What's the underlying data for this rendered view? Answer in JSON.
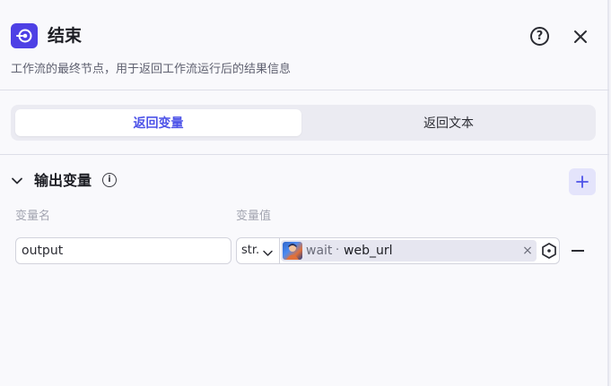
{
  "header": {
    "icon": "end-node-icon",
    "title": "结束",
    "description": "工作流的最终节点，用于返回工作流运行后的结果信息",
    "help_icon": "question-circle-icon",
    "close_icon": "close-icon"
  },
  "tabs": [
    {
      "label": "返回变量",
      "active": true
    },
    {
      "label": "返回文本",
      "active": false
    }
  ],
  "output_section": {
    "title": "输出变量",
    "info_icon": "info-icon",
    "add_icon": "plus-icon",
    "columns": {
      "name": "变量名",
      "value": "变量值"
    },
    "rows": [
      {
        "name": "output",
        "type": "str.",
        "ref_node": "wait",
        "ref_sep": "·",
        "ref_var": "web_url",
        "clear_label": "×"
      }
    ]
  },
  "colors": {
    "accent": "#4d53e8",
    "node_icon_bg": "#4e40e5",
    "add_button_bg": "#e4e4fb"
  }
}
